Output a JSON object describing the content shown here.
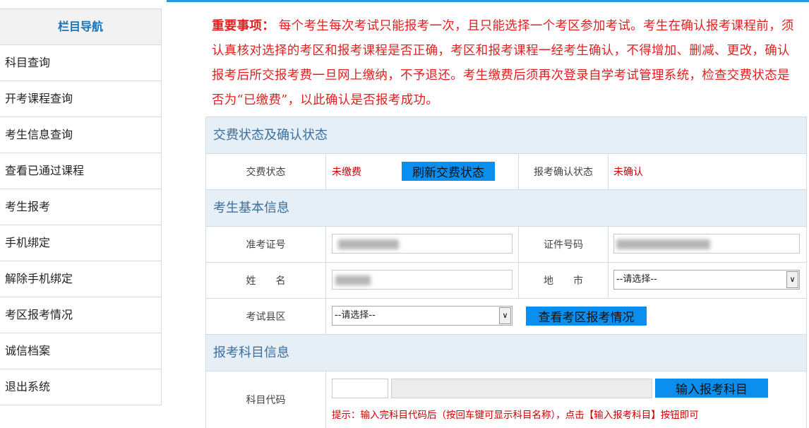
{
  "sidebar": {
    "title": "栏目导航",
    "items": [
      {
        "label": "科目查询"
      },
      {
        "label": "开考课程查询"
      },
      {
        "label": "考生信息查询"
      },
      {
        "label": "查看已通过课程"
      },
      {
        "label": "考生报考"
      },
      {
        "label": "手机绑定"
      },
      {
        "label": "解除手机绑定"
      },
      {
        "label": "考区报考情况"
      },
      {
        "label": "诚信档案"
      },
      {
        "label": "退出系统"
      }
    ]
  },
  "notice": {
    "heading": "重要事项：",
    "body": "每个考生每次考试只能报考一次，且只能选择一个考区参加考试。考生在确认报考课程前，须认真核对选择的考区和报考课程是否正确，考区和报考课程一经考生确认，不得增加、删减、更改，确认报考后所交报考费一旦网上缴纳，不予退还。考生缴费后须再次登录自学考试管理系统，检查交费状态是否为“已缴费”，以此确认是否报考成功。"
  },
  "status_section": {
    "title": "交费状态及确认状态",
    "payment_label": "交费状态",
    "payment_value": "未缴费",
    "refresh_button": "刷新交费状态",
    "confirm_label": "报考确认状态",
    "confirm_value": "未确认"
  },
  "basic_section": {
    "title": "考生基本信息",
    "ticket_label": "准考证号",
    "id_label": "证件号码",
    "name_label": "姓　　名",
    "city_label": "地　　市",
    "city_selected": "--请选择--",
    "county_label": "考试县区",
    "county_selected": "--请选择--",
    "view_button": "查看考区报考情况"
  },
  "subject_section": {
    "title": "报考科目信息",
    "code_label": "科目代码",
    "input_button": "输入报考科目",
    "hint": "提示：输入完科目代码后（按回车键可显示科目名称），点击【输入报考科目】按钮即可"
  },
  "colors": {
    "accent": "#0a8fee",
    "warning_text": "#e02020",
    "section_bg": "#e6eef6",
    "section_text": "#3a6f9e",
    "nav_title": "#1a73b5"
  }
}
